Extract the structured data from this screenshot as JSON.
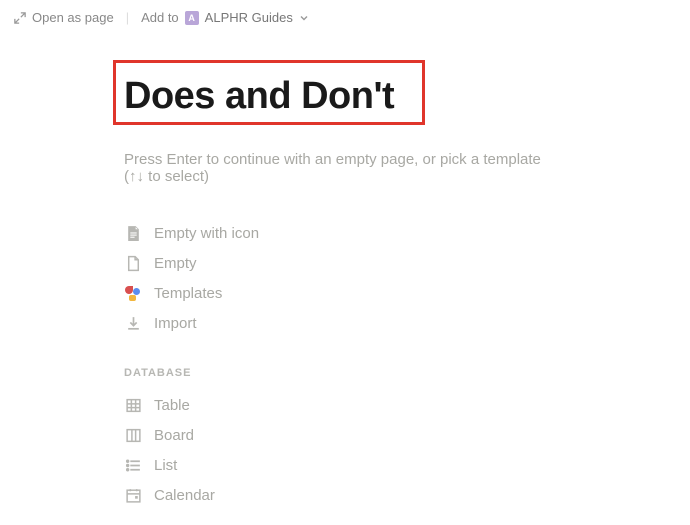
{
  "topbar": {
    "open_as_page": "Open as page",
    "add_to_label": "Add to",
    "workspace_initial": "A",
    "workspace_name": "ALPHR Guides"
  },
  "page": {
    "title": "Does and Don't",
    "hint": "Press Enter to continue with an empty page, or pick a template (↑↓ to select)"
  },
  "options": [
    {
      "icon": "page-with-icon",
      "label": "Empty with icon"
    },
    {
      "icon": "page",
      "label": "Empty"
    },
    {
      "icon": "templates",
      "label": "Templates"
    },
    {
      "icon": "import",
      "label": "Import"
    }
  ],
  "database": {
    "section_label": "DATABASE",
    "items": [
      {
        "icon": "table",
        "label": "Table"
      },
      {
        "icon": "board",
        "label": "Board"
      },
      {
        "icon": "list",
        "label": "List"
      },
      {
        "icon": "calendar",
        "label": "Calendar"
      }
    ]
  }
}
